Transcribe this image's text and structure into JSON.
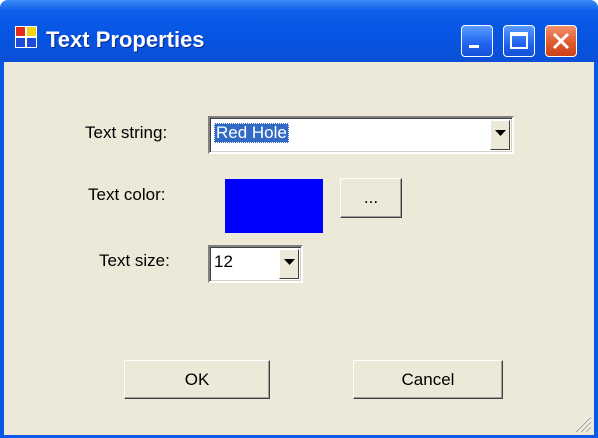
{
  "window": {
    "title": "Text Properties",
    "app_icon": "window-app-icon",
    "controls": {
      "minimize_icon": "minimize-icon",
      "maximize_icon": "maximize-icon",
      "close_icon": "close-icon"
    }
  },
  "form": {
    "text_string": {
      "label": "Text string:",
      "value": "Red Hole"
    },
    "text_color": {
      "label": "Text color:",
      "color": "#0000ff",
      "browse_label": "..."
    },
    "text_size": {
      "label": "Text size:",
      "value": "12"
    }
  },
  "buttons": {
    "ok": "OK",
    "cancel": "Cancel"
  },
  "colors": {
    "titlebar": "#0655e4",
    "close_button": "#e15a2c",
    "dialog_background": "#ece9d8",
    "selection": "#316ac5"
  }
}
